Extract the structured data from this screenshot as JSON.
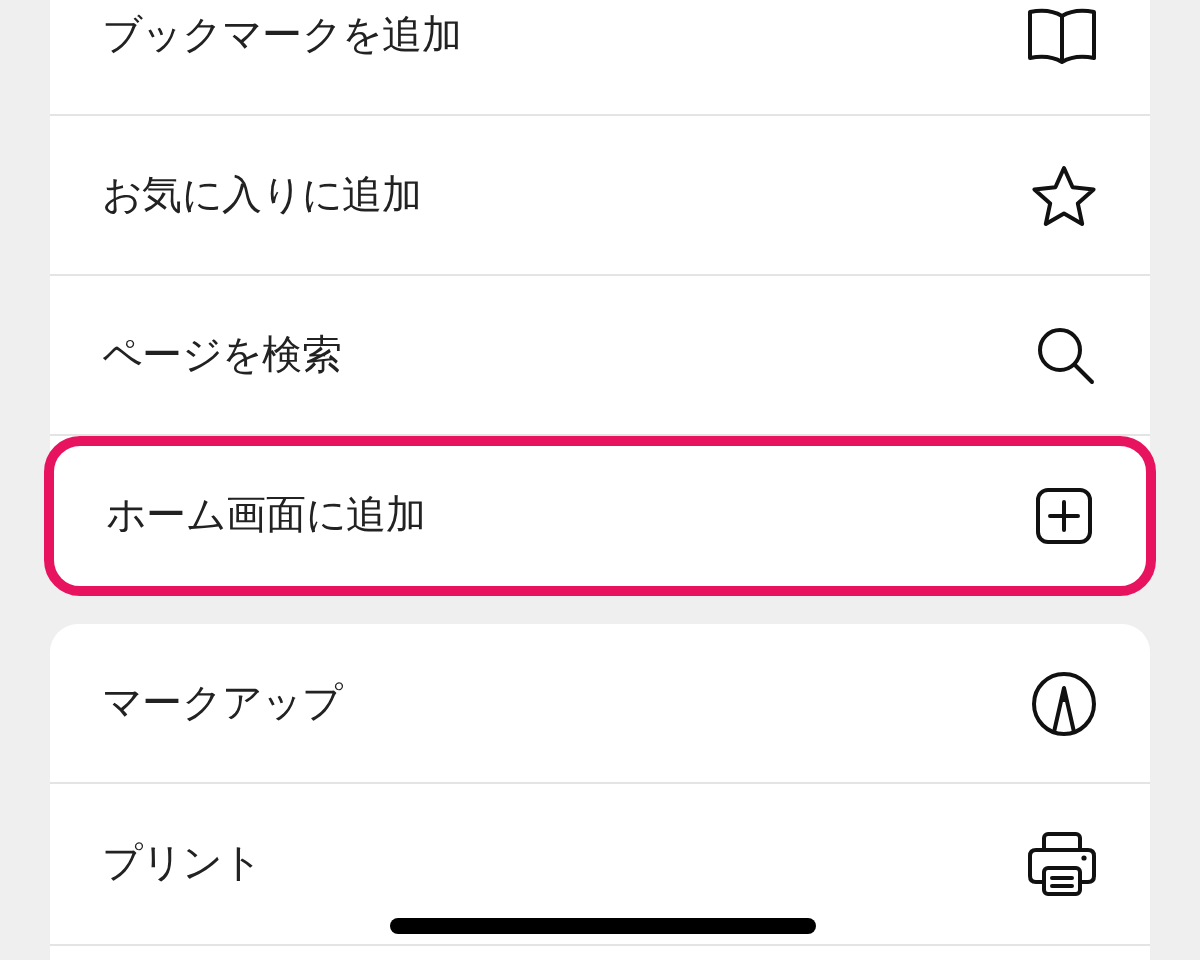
{
  "groups": [
    {
      "items": [
        {
          "label": "ブックマークを追加",
          "highlighted": false
        },
        {
          "label": "お気に入りに追加",
          "highlighted": false
        },
        {
          "label": "ページを検索",
          "highlighted": false
        },
        {
          "label": "ホーム画面に追加",
          "highlighted": true
        }
      ]
    },
    {
      "items": [
        {
          "label": "マークアップ",
          "highlighted": false
        },
        {
          "label": "プリント",
          "highlighted": false
        }
      ]
    }
  ]
}
